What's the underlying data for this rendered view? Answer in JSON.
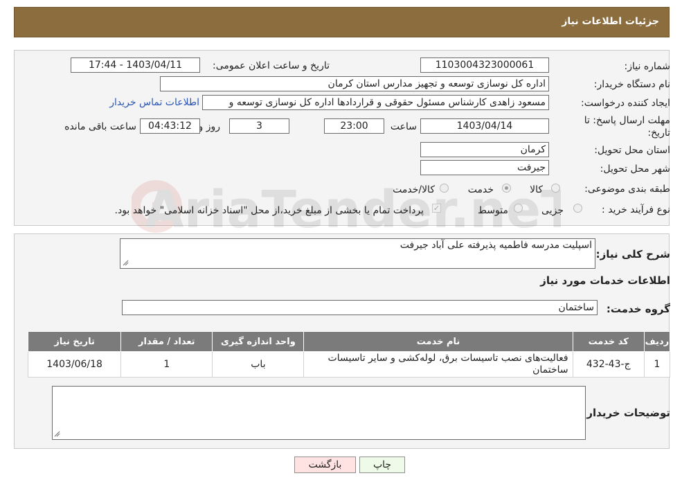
{
  "header": {
    "title": "جزئیات اطلاعات نیاز"
  },
  "watermark": {
    "text": "AriaTender.neT"
  },
  "info": {
    "need_number_label": "شماره نیاز:",
    "need_number": "1103004323000061",
    "announce_label": "تاریخ و ساعت اعلان عمومی:",
    "announce_value": "1403/04/11 - 17:44",
    "buyer_org_label": "نام دستگاه خریدار:",
    "buyer_org": "اداره کل نوسازی  توسعه و تجهیز مدارس استان کرمان",
    "creator_label": "ایجاد کننده درخواست:",
    "creator": "مسعود زاهدی کارشناس مسئول حقوقی و قراردادها اداره کل نوسازی  توسعه و",
    "contact_link": "اطلاعات تماس خریدار",
    "deadline_label_1": "مهلت ارسال پاسخ: تا",
    "deadline_label_2": "تاریخ:",
    "deadline_date": "1403/04/14",
    "time_label": "ساعت",
    "deadline_time": "23:00",
    "days_value": "3",
    "days_label": "روز و",
    "remaining_time": "04:43:12",
    "remaining_label": "ساعت باقی مانده",
    "province_label": "استان محل تحویل:",
    "province": "کرمان",
    "city_label": "شهر محل تحویل:",
    "city": "جیرفت",
    "category_label": "طبقه بندی موضوعی:",
    "category_options": [
      "کالا",
      "خدمت",
      "کالا/خدمت"
    ],
    "category_selected": "خدمت",
    "purchase_label": "نوع فرآیند خرید :",
    "purchase_options": [
      "جزیی",
      "متوسط"
    ],
    "purchase_note": "پرداخت تمام یا بخشی از مبلغ خرید،از محل \"اسناد خزانه اسلامی\" خواهد بود."
  },
  "details": {
    "summary_label": "شرح کلی نیاز:",
    "summary": "اسپلیت مدرسه فاطمیه پذیرفته علی آباد جیرفت",
    "services_title": "اطلاعات خدمات مورد نیاز",
    "service_group_label": "گروه خدمت:",
    "service_group": "ساختمان",
    "table": {
      "headers": [
        "ردیف",
        "کد خدمت",
        "نام خدمت",
        "واحد اندازه گیری",
        "تعداد / مقدار",
        "تاریخ نیاز"
      ],
      "rows": [
        [
          "1",
          "ج-43-432",
          "فعالیت‌های نصب تاسیسات برق، لوله‌کشی و سایر تاسیسات ساختمان",
          "باب",
          "1",
          "1403/06/18"
        ]
      ]
    },
    "buyer_notes_label": "توضیحات خریدار:",
    "buyer_notes": ""
  },
  "buttons": {
    "print": "چاپ",
    "back": "بازگشت"
  },
  "colors": {
    "header": "#8c6d3d",
    "print_bg": "#eefbe8",
    "back_bg": "#ffe3e3",
    "table_header": "#7b7b7b",
    "link": "#2a55b3"
  }
}
